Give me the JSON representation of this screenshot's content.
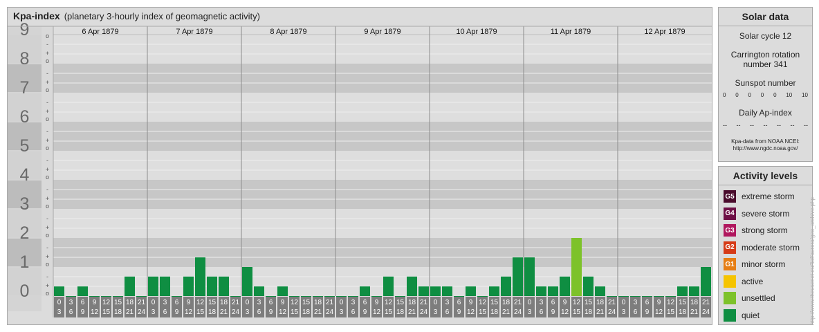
{
  "header": {
    "title": "Kpa-index",
    "subtitle": "(planetary 3-hourly index of geomagnetic activity)"
  },
  "chart_data": {
    "type": "bar",
    "title": "Kpa-index",
    "subtitle": "(planetary 3-hourly index of geomagnetic activity)",
    "ylim": [
      0,
      9
    ],
    "y_major_ticks": [
      "0",
      "1",
      "2",
      "3",
      "4",
      "5",
      "6",
      "7",
      "8",
      "9"
    ],
    "y_minor_ticks": [
      "o",
      "+",
      "-"
    ],
    "days": [
      "6 Apr 1879",
      "7 Apr 1879",
      "8 Apr 1879",
      "9 Apr 1879",
      "10 Apr 1879",
      "11 Apr 1879",
      "12 Apr 1879"
    ],
    "interval_labels": [
      [
        "0",
        "3"
      ],
      [
        "3",
        "6"
      ],
      [
        "6",
        "9"
      ],
      [
        "9",
        "12"
      ],
      [
        "12",
        "15"
      ],
      [
        "15",
        "18"
      ],
      [
        "18",
        "21"
      ],
      [
        "21",
        "24"
      ]
    ],
    "values": [
      [
        0.33,
        0,
        0.33,
        0,
        0,
        0,
        0.67,
        0
      ],
      [
        0.67,
        0.67,
        0,
        0.67,
        1.33,
        0.67,
        0.67,
        0
      ],
      [
        1.0,
        0.33,
        0,
        0.33,
        0,
        0,
        0,
        0
      ],
      [
        0,
        0,
        0.33,
        0,
        0.67,
        0,
        0.67,
        0.33
      ],
      [
        0.33,
        0.33,
        0,
        0.33,
        0,
        0.33,
        0.67,
        1.33
      ],
      [
        1.33,
        0.33,
        0.33,
        0.67,
        2.0,
        0.67,
        0.33,
        0
      ],
      [
        0,
        0,
        0,
        0,
        0,
        0.33,
        0.33,
        1.0
      ]
    ],
    "color_quiet": "#0f8e42",
    "color_unsettled": "#7dc22a"
  },
  "solar": {
    "title": "Solar data",
    "cycle": "Solar cycle 12",
    "carrington_line1": "Carrington rotation",
    "carrington_line2": "number 341",
    "sunspot_label": "Sunspot number",
    "sunspot_values": [
      "0",
      "0",
      "0",
      "0",
      "0",
      "10",
      "10"
    ],
    "ap_label": "Daily Ap-index",
    "ap_values": [
      "--",
      "--",
      "--",
      "--",
      "--",
      "--",
      "--"
    ],
    "credit_line1": "Kpa-data from NOAA NCEI:",
    "credit_line2": "http://www.ngdc.noaa.gov/"
  },
  "activity": {
    "title": "Activity levels",
    "levels": [
      {
        "badge": "G5",
        "label": "extreme storm",
        "color": "#4a0b2c"
      },
      {
        "badge": "G4",
        "label": "severe storm",
        "color": "#6e0f45"
      },
      {
        "badge": "G3",
        "label": "strong storm",
        "color": "#b0175e"
      },
      {
        "badge": "G2",
        "label": "moderate storm",
        "color": "#d63b17"
      },
      {
        "badge": "G1",
        "label": "minor storm",
        "color": "#e67e14"
      },
      {
        "badge": "",
        "label": "active",
        "color": "#f5c400"
      },
      {
        "badge": "",
        "label": "unsettled",
        "color": "#7dc22a"
      },
      {
        "badge": "",
        "label": "quiet",
        "color": "#0f8e42"
      }
    ]
  },
  "watermark": "http://www.theusenet.eu/fiaf/aurora/geo_archive.php"
}
